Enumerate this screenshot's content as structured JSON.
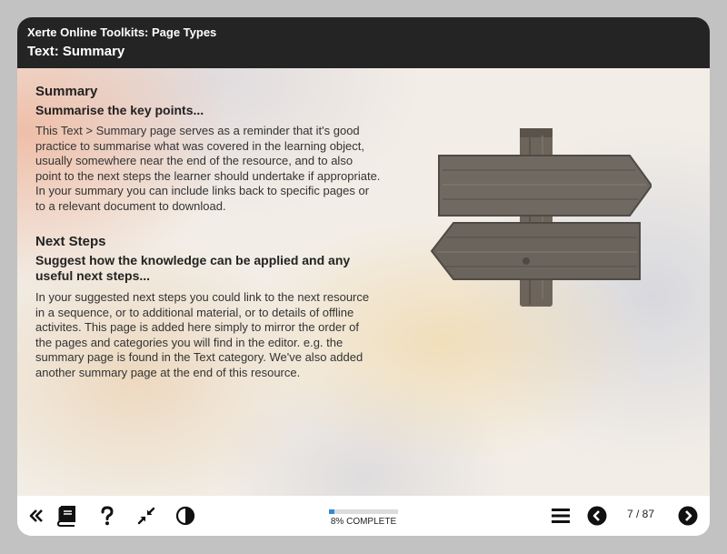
{
  "header": {
    "app_title": "Xerte Online Toolkits: Page Types",
    "page_title": "Text: Summary"
  },
  "content": {
    "summary_heading": "Summary",
    "summary_subheading": "Summarise the key points...",
    "summary_text": "This Text > Summary page serves as a reminder that it's good practice to summarise what was covered in the learning object, usually somewhere near the end of the resource, and to also point to the next steps the learner should undertake if appropriate. In your summary you can include links back to specific pages or to a relevant document to download.",
    "next_heading": "Next Steps",
    "next_subheading": "Suggest how the knowledge can be applied and any useful next steps...",
    "next_text": "In your suggested next steps you could link to the next resource in a sequence, or to additional material, or to details of offline activites. This page is added here simply to mirror the order of the pages and categories you will find in the editor. e.g. the summary page is found in the Text category. We've also added another summary page at the end of this resource.",
    "image_name": "signpost-image"
  },
  "footer": {
    "progress_fraction": 0.08,
    "progress_label": "8% COMPLETE",
    "page_counter": "7 / 87",
    "icons": [
      "collapse-menu-icon",
      "glossary-book-icon",
      "help-icon",
      "minimize-icon",
      "contrast-icon",
      "table-of-contents-icon",
      "previous-page-icon",
      "next-page-icon"
    ]
  },
  "colors": {
    "header_bg": "#242424",
    "progress_fill": "#2d8ad9",
    "page_bg": "#c2c2c2"
  }
}
